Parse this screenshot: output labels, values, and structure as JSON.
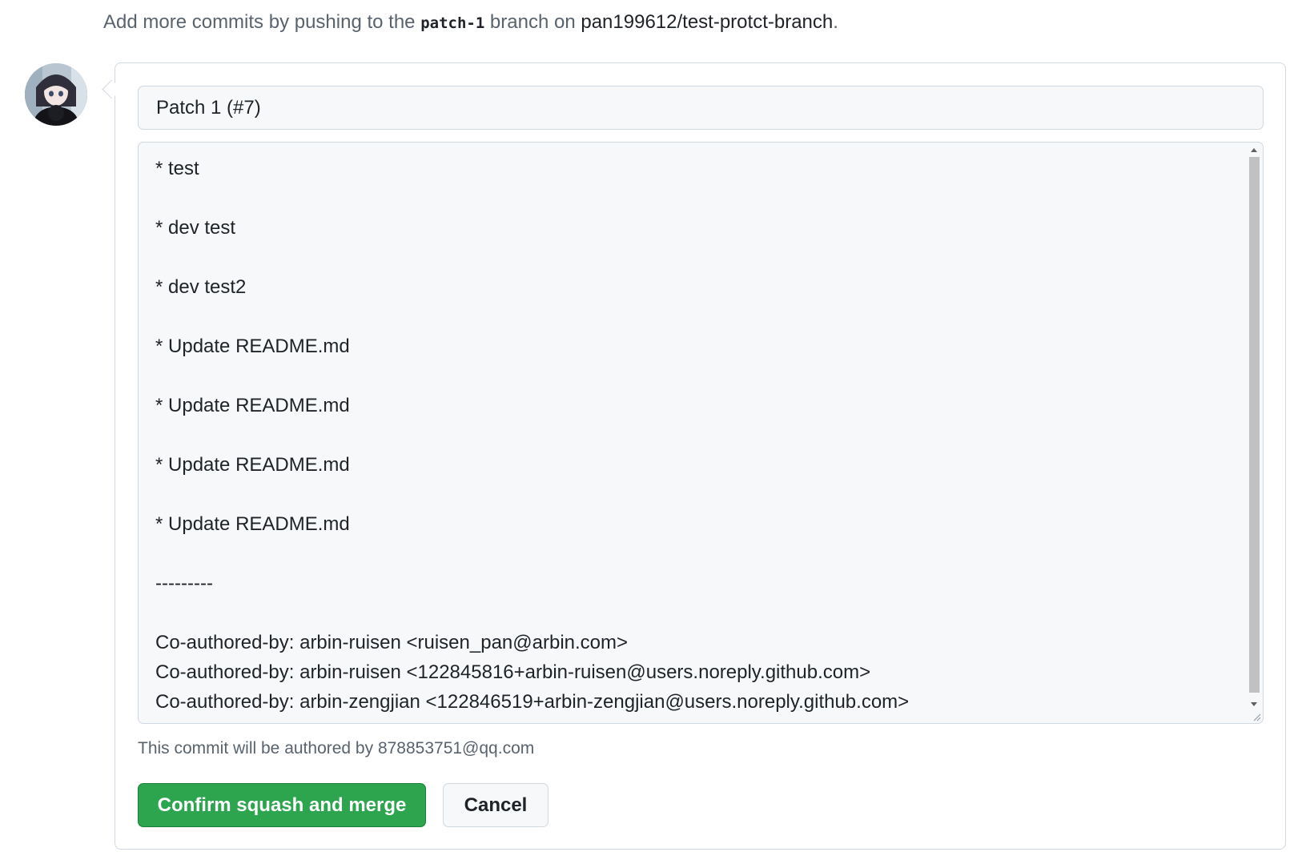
{
  "header": {
    "prefix": "Add more commits by pushing to the ",
    "branch": "patch-1",
    "middle": " branch on ",
    "repo": "pan199612/test-protct-branch",
    "suffix": "."
  },
  "commit": {
    "title": "Patch 1 (#7)",
    "message_lines": [
      "* test",
      "",
      "* dev test",
      "",
      "* dev test2",
      "",
      "* Update README.md",
      "",
      "* Update README.md",
      "",
      "* Update README.md",
      "",
      "* Update README.md",
      "",
      "---------",
      "",
      "Co-authored-by: arbin-ruisen <ruisen_pan@arbin.com>",
      "Co-authored-by: arbin-ruisen <122845816+arbin-ruisen@users.noreply.github.com>",
      "Co-authored-by: arbin-zengjian <122846519+arbin-zengjian@users.noreply.github.com>"
    ],
    "author_note": "This commit will be authored by 878853751@qq.com"
  },
  "actions": {
    "confirm_label": "Confirm squash and merge",
    "cancel_label": "Cancel"
  },
  "colors": {
    "confirm_bg": "#2da44e",
    "input_bg": "#f6f8fa",
    "border": "#d1d9e0"
  }
}
